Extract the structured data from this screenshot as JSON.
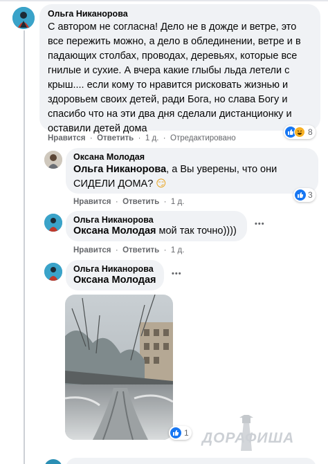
{
  "comments": [
    {
      "author": "Ольга Никанорова",
      "lines": [
        "С автором не согласна! Дело не в дожде и ветре, это",
        "все пережить можно, а дело в облединении, ветре и в",
        "падающих столбах, проводах, деревьях, которые все",
        "гнилые и сухие. А вчера какие глыбы льда летели с",
        "крыш.... если кому то нравится рисковать жизнью и",
        "здоровьем своих детей, ради Бога, но слава Богу и",
        "спасибо что на эти два дня сделали дистанционку и",
        "оставили детей дома"
      ],
      "like": "Нравится",
      "reply": "Ответить",
      "time": "1 д.",
      "edited": "Отредактировано",
      "reactions_count": "8"
    },
    {
      "author": "Оксана Молодая",
      "mention": "Ольга Никанорова",
      "text_line1": ", а Вы уверены, что они",
      "text_line2": "СИДЕЛИ ДОМА?",
      "emoji": "😏",
      "like": "Нравится",
      "reply": "Ответить",
      "time": "1 д.",
      "reactions_count": "3"
    },
    {
      "author": "Ольга Никанорова",
      "mention": "Оксана Молодая",
      "text": " мой так точно))))",
      "like": "Нравится",
      "reply": "Ответить",
      "time": "1 д.",
      "more": "•••"
    },
    {
      "author": "Ольга Никанорова",
      "mention": "Оксана Молодая",
      "more": "•••",
      "reactions_count": "1"
    }
  ],
  "watermark": "ДОРАФИША",
  "colors": {
    "bubble": "#f0f2f5",
    "meta": "#65676b",
    "like_blue": "#1877f2",
    "haha_yellow": "#f7b125"
  }
}
